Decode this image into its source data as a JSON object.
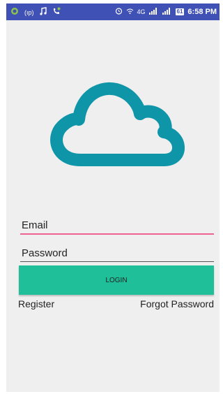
{
  "status_bar": {
    "network": "(ıp)",
    "signal_text": "4G",
    "battery": "61",
    "time": "6:58 PM"
  },
  "form": {
    "email_placeholder": "Email",
    "password_placeholder": "Password",
    "login_label": "LOGIN",
    "register_label": "Register",
    "forgot_label": "Forgot Password"
  },
  "colors": {
    "status_bar": "#3f51b5",
    "cloud": "#0f95a8",
    "login_button": "#1fbf99",
    "email_underline": "#f06292"
  },
  "icons": [
    "camera-icon",
    "hotspot-icon",
    "music-icon",
    "call-icon",
    "alarm-icon",
    "wifi-icon",
    "signal-icon",
    "battery-icon",
    "cloud-logo-icon"
  ]
}
